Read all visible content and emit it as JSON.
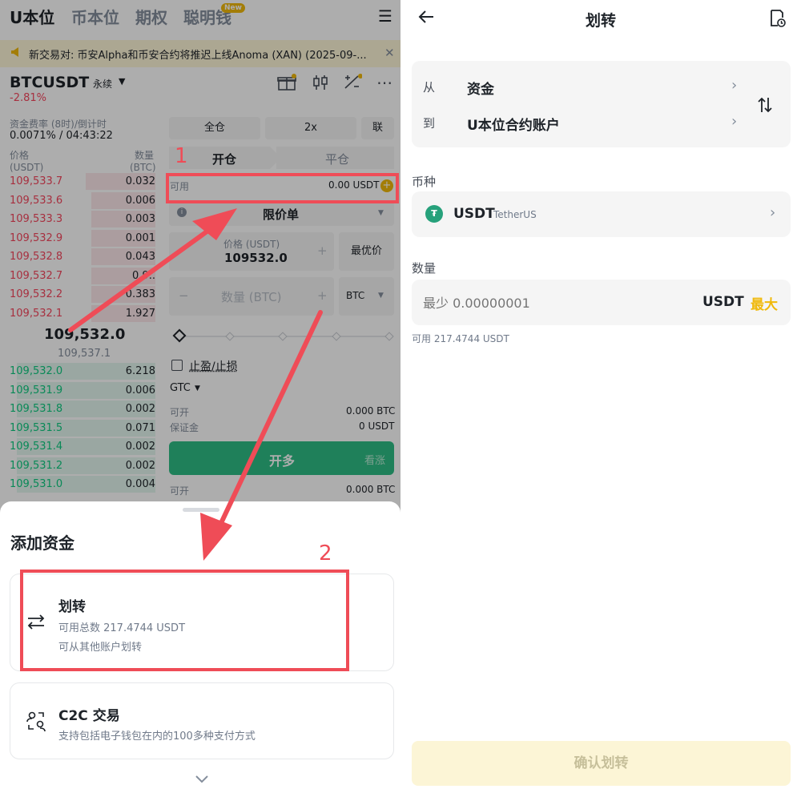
{
  "left": {
    "top_tabs": [
      "U本位",
      "币本位",
      "期权",
      "聪明钱"
    ],
    "new_badge": "New",
    "announcement": "新交易对: 币安Alpha和币安合约将推迟上线Anoma (XAN) (2025-09-...",
    "symbol": "BTCUSDT",
    "contract_type": "永续",
    "change": "-2.81%",
    "funding_label": "资金费率 (8时)/倒计时",
    "funding_value": "0.0071% / 04:43:22",
    "col_price": "价格",
    "col_price_unit": "(USDT)",
    "col_qty": "数量",
    "col_qty_unit": "(BTC)",
    "asks": [
      {
        "price": "109,533.7",
        "qty": "0.032",
        "depth": 0.48
      },
      {
        "price": "109,533.6",
        "qty": "0.006",
        "depth": 0.44
      },
      {
        "price": "109,533.3",
        "qty": "0.003",
        "depth": 0.44
      },
      {
        "price": "109,532.9",
        "qty": "0.001",
        "depth": 0.44
      },
      {
        "price": "109,532.8",
        "qty": "0.043",
        "depth": 0.44
      },
      {
        "price": "109,532.7",
        "qty": "0.9..",
        "depth": 0.44
      },
      {
        "price": "109,532.2",
        "qty": "0.383",
        "depth": 0.44
      },
      {
        "price": "109,532.1",
        "qty": "1.927",
        "depth": 0.44
      }
    ],
    "last_price": "109,532.0",
    "mark_price": "109,537.1",
    "bids": [
      {
        "price": "109,532.0",
        "qty": "6.218",
        "depth": 0.95
      },
      {
        "price": "109,531.9",
        "qty": "0.006",
        "depth": 0.95
      },
      {
        "price": "109,531.8",
        "qty": "0.002",
        "depth": 0.95
      },
      {
        "price": "109,531.5",
        "qty": "0.071",
        "depth": 0.95
      },
      {
        "price": "109,531.4",
        "qty": "0.002",
        "depth": 0.95
      },
      {
        "price": "109,531.2",
        "qty": "0.002",
        "depth": 0.95
      },
      {
        "price": "109,531.0",
        "qty": "0.004",
        "depth": 0.95
      }
    ],
    "margin_mode": "全仓",
    "leverage": "2x",
    "mode_btn": "联",
    "tab_open": "开仓",
    "tab_close": "平仓",
    "available_label": "可用",
    "available_value": "0.00 USDT",
    "order_type": "限价单",
    "price_label": "价格 (USDT)",
    "price_value": "109532.0",
    "best_price": "最优价",
    "qty_placeholder": "数量 (BTC)",
    "qty_unit": "BTC",
    "tpsl": "止盈/止损",
    "tif": "GTC",
    "can_open_label": "可开",
    "can_open_value": "0.000 BTC",
    "margin_label": "保证金",
    "margin_value": "0 USDT",
    "buy_btn": "开多",
    "buy_sub": "看涨",
    "can_open_label2": "可开",
    "can_open_value2": "0.000 BTC",
    "sheet": {
      "title": "添加资金",
      "transfer_title": "划转",
      "transfer_sub1": "可用总数 217.4744 USDT",
      "transfer_sub2": "可从其他账户划转",
      "c2c_title": "C2C 交易",
      "c2c_sub": "支持包括电子钱包在内的100多种支付方式"
    },
    "annot_1": "1",
    "annot_2": "2"
  },
  "right": {
    "title": "划转",
    "from_label": "从",
    "from_value": "资金",
    "to_label": "到",
    "to_value": "U本位合约账户",
    "coin_label": "币种",
    "coin_symbol": "USDT",
    "coin_name": "TetherUS",
    "amount_label": "数量",
    "amount_placeholder": "最少 0.00000001",
    "amount_unit": "USDT",
    "max_label": "最大",
    "available": "可用 217.4744 USDT",
    "confirm": "确认划转"
  },
  "colors": {
    "accent": "#f0b90b",
    "sell": "#f6465d",
    "buy": "#0ecb81",
    "annotation": "#ef4c57"
  }
}
